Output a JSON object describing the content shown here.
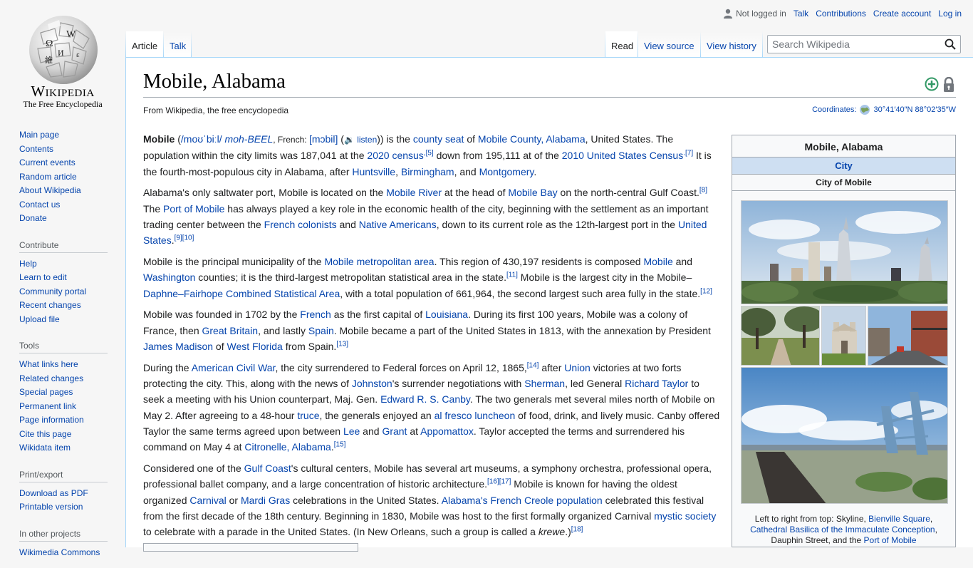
{
  "logo": {
    "wordmark": "Wikipedia",
    "tagline": "The Free Encyclopedia"
  },
  "personal": {
    "not_logged_in": "Not logged in",
    "talk": "Talk",
    "contributions": "Contributions",
    "create_account": "Create account",
    "log_in": "Log in"
  },
  "tabs": {
    "article": "Article",
    "talk": "Talk",
    "read": "Read",
    "view_source": "View source",
    "view_history": "View history"
  },
  "search": {
    "placeholder": "Search Wikipedia"
  },
  "sidebar": {
    "nav": [
      "Main page",
      "Contents",
      "Current events",
      "Random article",
      "About Wikipedia",
      "Contact us",
      "Donate"
    ],
    "contribute": {
      "heading": "Contribute",
      "items": [
        "Help",
        "Learn to edit",
        "Community portal",
        "Recent changes",
        "Upload file"
      ]
    },
    "tools": {
      "heading": "Tools",
      "items": [
        "What links here",
        "Related changes",
        "Special pages",
        "Permanent link",
        "Page information",
        "Cite this page",
        "Wikidata item"
      ]
    },
    "print": {
      "heading": "Print/export",
      "items": [
        "Download as PDF",
        "Printable version"
      ]
    },
    "projects": {
      "heading": "In other projects",
      "items": [
        "Wikimedia Commons"
      ]
    }
  },
  "page": {
    "title": "Mobile, Alabama",
    "sitesub": "From Wikipedia, the free encyclopedia",
    "coords_label": "Coordinates:",
    "coords_value": "30°41′40″N 88°02′35″W"
  },
  "infobox": {
    "title": "Mobile, Alabama",
    "type": "City",
    "official_name": "City of Mobile",
    "caption": {
      "prefix": "Left to right from top: Skyline, ",
      "link1": "Bienville Square",
      "sep1": ", ",
      "link2": "Cathedral Basilica of the Immaculate Conception",
      "sep2": ", Dauphin Street, and the ",
      "link3": "Port of Mobile"
    }
  },
  "body": {
    "p1": [
      {
        "t": "Mobile",
        "b": true
      },
      {
        "t": " ("
      },
      {
        "t": "/moʊˈbiːl/",
        "l": true
      },
      {
        "t": " "
      },
      {
        "t": "moh-BEEL",
        "l": true,
        "i": true
      },
      {
        "t": ", French: ",
        "s": true
      },
      {
        "t": "[mɔbil]",
        "l": true
      },
      {
        "t": " ("
      },
      {
        "t": "🔉 listen",
        "l": true,
        "s": true
      },
      {
        "t": ")) is the "
      },
      {
        "t": "county seat",
        "l": true
      },
      {
        "t": " of "
      },
      {
        "t": "Mobile County, Alabama",
        "l": true
      },
      {
        "t": ", United States. The population within the city limits was 187,041 at the "
      },
      {
        "t": "2020 census",
        "l": true
      },
      {
        "t": ",[5]",
        "sup": true
      },
      {
        "t": " down from 195,111 at of the "
      },
      {
        "t": "2010 United States Census",
        "l": true
      },
      {
        "t": ".[7]",
        "sup": true
      },
      {
        "t": " It is the fourth-most-populous city in Alabama, after "
      },
      {
        "t": "Huntsville",
        "l": true
      },
      {
        "t": ", "
      },
      {
        "t": "Birmingham",
        "l": true
      },
      {
        "t": ", and "
      },
      {
        "t": "Montgomery",
        "l": true
      },
      {
        "t": "."
      }
    ],
    "p2": [
      {
        "t": "Alabama's only saltwater port, Mobile is located on the "
      },
      {
        "t": "Mobile River",
        "l": true
      },
      {
        "t": " at the head of "
      },
      {
        "t": "Mobile Bay",
        "l": true
      },
      {
        "t": " on the north-central Gulf Coast."
      },
      {
        "t": "[8]",
        "sup": true
      },
      {
        "t": " The "
      },
      {
        "t": "Port of Mobile",
        "l": true
      },
      {
        "t": " has always played a key role in the economic health of the city, beginning with the settlement as an important trading center between the "
      },
      {
        "t": "French colonists",
        "l": true
      },
      {
        "t": " and "
      },
      {
        "t": "Native Americans",
        "l": true
      },
      {
        "t": ", down to its current role as the 12th-largest port in the "
      },
      {
        "t": "United States",
        "l": true
      },
      {
        "t": "."
      },
      {
        "t": "[9][10]",
        "sup": true
      }
    ],
    "p3": [
      {
        "t": "Mobile is the principal municipality of the "
      },
      {
        "t": "Mobile metropolitan area",
        "l": true
      },
      {
        "t": ". This region of 430,197 residents is composed "
      },
      {
        "t": "Mobile",
        "l": true
      },
      {
        "t": " and "
      },
      {
        "t": "Washington",
        "l": true
      },
      {
        "t": " counties; it is the third-largest metropolitan statistical area in the state."
      },
      {
        "t": "[11]",
        "sup": true
      },
      {
        "t": " Mobile is the largest city in the Mobile–"
      },
      {
        "t": "Daphne–Fairhope Combined Statistical Area",
        "l": true
      },
      {
        "t": ", with a total population of 661,964, the second largest such area fully in the state."
      },
      {
        "t": "[12]",
        "sup": true
      }
    ],
    "p4": [
      {
        "t": "Mobile was founded in 1702 by the "
      },
      {
        "t": "French",
        "l": true
      },
      {
        "t": " as the first capital of "
      },
      {
        "t": "Louisiana",
        "l": true
      },
      {
        "t": ". During its first 100 years, Mobile was a colony of France, then "
      },
      {
        "t": "Great Britain",
        "l": true
      },
      {
        "t": ", and lastly "
      },
      {
        "t": "Spain",
        "l": true
      },
      {
        "t": ". Mobile became a part of the United States in 1813, with the annexation by President "
      },
      {
        "t": "James Madison",
        "l": true
      },
      {
        "t": " of "
      },
      {
        "t": "West Florida",
        "l": true
      },
      {
        "t": " from Spain."
      },
      {
        "t": "[13]",
        "sup": true
      }
    ],
    "p5": [
      {
        "t": "During the "
      },
      {
        "t": "American Civil War",
        "l": true
      },
      {
        "t": ", the city surrendered to Federal forces on April 12, 1865,"
      },
      {
        "t": "[14]",
        "sup": true
      },
      {
        "t": " after "
      },
      {
        "t": "Union",
        "l": true
      },
      {
        "t": " victories at two forts protecting the city. This, along with the news of "
      },
      {
        "t": "Johnston",
        "l": true
      },
      {
        "t": "'s surrender negotiations with "
      },
      {
        "t": "Sherman",
        "l": true
      },
      {
        "t": ", led General "
      },
      {
        "t": "Richard Taylor",
        "l": true
      },
      {
        "t": " to seek a meeting with his Union counterpart, Maj. Gen. "
      },
      {
        "t": "Edward R. S. Canby",
        "l": true
      },
      {
        "t": ". The two generals met several miles north of Mobile on May 2. After agreeing to a 48-hour "
      },
      {
        "t": "truce",
        "l": true
      },
      {
        "t": ", the generals enjoyed an "
      },
      {
        "t": "al fresco luncheon",
        "l": true
      },
      {
        "t": " of food, drink, and lively music. Canby offered Taylor the same terms agreed upon between "
      },
      {
        "t": "Lee",
        "l": true
      },
      {
        "t": " and "
      },
      {
        "t": "Grant",
        "l": true
      },
      {
        "t": " at "
      },
      {
        "t": "Appomattox",
        "l": true
      },
      {
        "t": ". Taylor accepted the terms and surrendered his command on May 4 at "
      },
      {
        "t": "Citronelle, Alabama",
        "l": true
      },
      {
        "t": "."
      },
      {
        "t": "[15]",
        "sup": true
      }
    ],
    "p6": [
      {
        "t": "Considered one of the "
      },
      {
        "t": "Gulf Coast",
        "l": true
      },
      {
        "t": "'s cultural centers, Mobile has several art museums, a symphony orchestra, professional opera, professional ballet company, and a large concentration of historic architecture."
      },
      {
        "t": "[16][17]",
        "sup": true
      },
      {
        "t": " Mobile is known for having the oldest organized "
      },
      {
        "t": "Carnival",
        "l": true
      },
      {
        "t": " or "
      },
      {
        "t": "Mardi Gras",
        "l": true
      },
      {
        "t": " celebrations in the United States. "
      },
      {
        "t": "Alabama's French Creole population",
        "l": true
      },
      {
        "t": " celebrated this festival from the first decade of the 18th century. Beginning in 1830, Mobile was host to the first formally organized Carnival "
      },
      {
        "t": "mystic society",
        "l": true
      },
      {
        "t": " to celebrate with a parade in the United States. (In New Orleans, such a group is called a "
      },
      {
        "t": "krewe",
        "i": true
      },
      {
        "t": ".)"
      },
      {
        "t": "[18]",
        "sup": true
      }
    ]
  },
  "colors": {
    "link": "#0645ad",
    "tab_border": "#a7d7f9",
    "infobox_header": "#cedff2"
  }
}
